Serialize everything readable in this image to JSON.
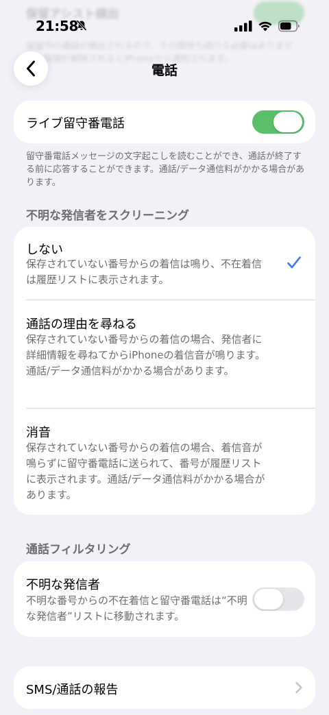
{
  "ghost": {
    "title": "保留アシスト検出",
    "text": "保留中の通話が検出されるので、その間待ち続ける必要はありません。保留が解除されるとiPhoneから通知されます。"
  },
  "status_bar": {
    "time": "21:58",
    "bell_icon": "bell-slash-icon",
    "signal_icon": "cellular-signal-icon",
    "wifi_icon": "wifi-icon",
    "battery_icon": "battery-icon"
  },
  "nav": {
    "back_icon": "chevron-left-icon",
    "title": "電話"
  },
  "live_voicemail": {
    "label": "ライブ留守番電話",
    "enabled": true,
    "footnote": "留守番電話メッセージの文字起こしを読むことができ、通話が終了する前に応答することができます。通話/データ通信料がかかる場合があります。"
  },
  "screening": {
    "header": "不明な発信者をスクリーニング",
    "options": [
      {
        "title": "しない",
        "description": "保存されていない番号からの着信は鳴り、不在着信は履歴リストに表示されます。",
        "selected": true
      },
      {
        "title": "通話の理由を尋ねる",
        "description": "保存されていない番号からの着信の場合、発信者に詳細情報を尋ねてからiPhoneの着信音が鳴ります。通話/データ通信料がかかる場合があります。",
        "selected": false
      },
      {
        "title": "消音",
        "description": "保存されていない番号からの着信の場合、着信音が鳴らずに留守番電話に送られて、番号が履歴リストに表示されます。通話/データ通信料がかかる場合があります。",
        "selected": false
      }
    ]
  },
  "filtering": {
    "header": "通話フィルタリング",
    "unknown_callers": {
      "label": "不明な発信者",
      "description": "不明な番号からの不在着信と留守番電話は“不明な発信者”リストに移動されます。",
      "enabled": false
    }
  },
  "sms_report": {
    "label": "SMS/通話の報告"
  },
  "colors": {
    "accent": "#3478f6",
    "toggle_on": "#5bbf6a",
    "background": "#f2f1f7"
  }
}
